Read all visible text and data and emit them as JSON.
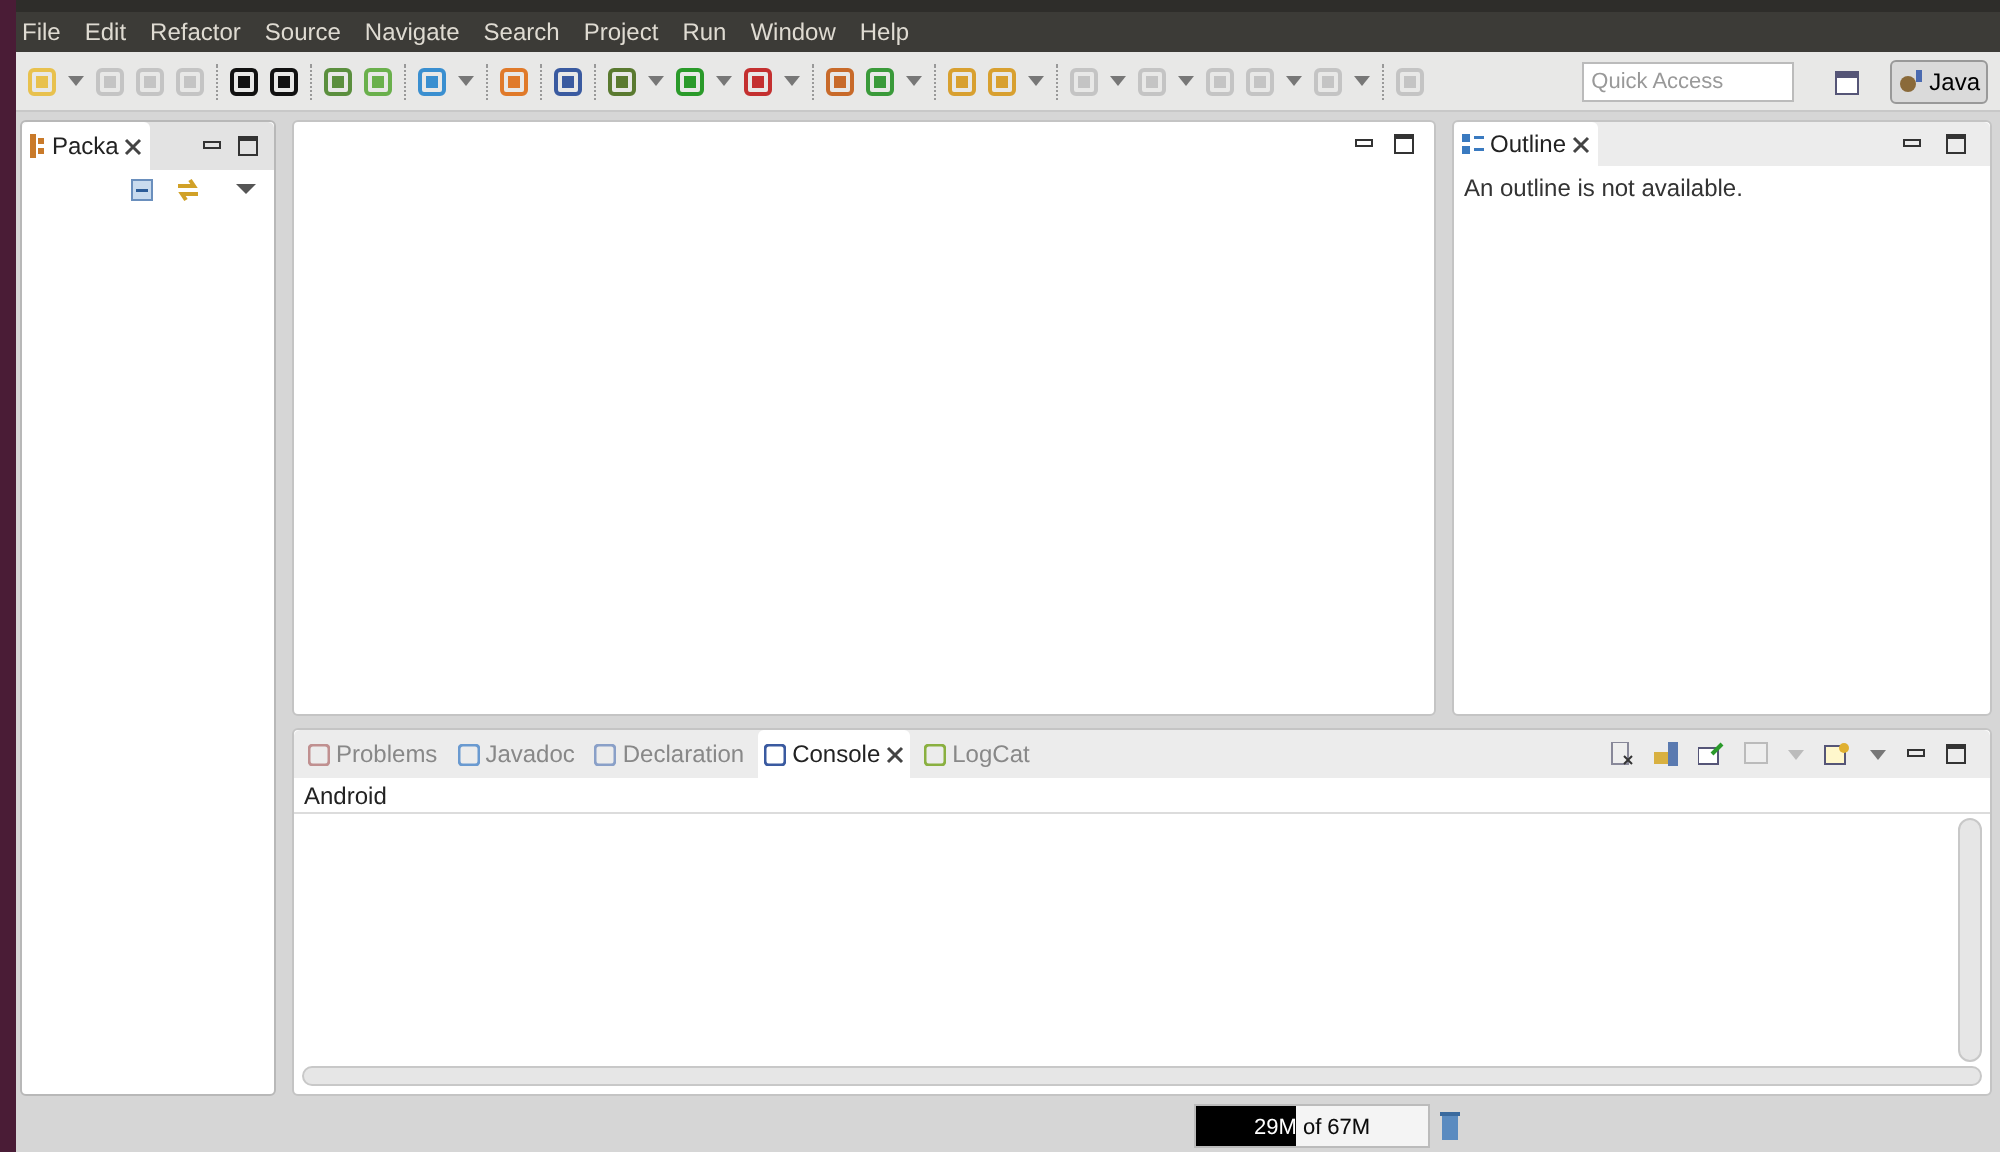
{
  "menu_bar": [
    "File",
    "Edit",
    "Refactor",
    "Source",
    "Navigate",
    "Search",
    "Project",
    "Run",
    "Window",
    "Help"
  ],
  "toolbar": {
    "quick_access": {
      "placeholder": "Quick Access"
    },
    "perspective": {
      "label": "Java",
      "selected": true
    }
  },
  "package_explorer": {
    "tab": {
      "label": "Packa",
      "selected": true
    }
  },
  "outline": {
    "tab": {
      "label": "Outline",
      "selected": true
    },
    "message": "An outline is not available."
  },
  "bottom_panel": {
    "tabs": [
      {
        "label": "Problems",
        "selected": false
      },
      {
        "label": "Javadoc",
        "selected": false
      },
      {
        "label": "Declaration",
        "selected": false
      },
      {
        "label": "Console",
        "selected": true
      },
      {
        "label": "LogCat",
        "selected": false
      }
    ],
    "console_title": "Android"
  },
  "status_bar": {
    "heap": "29M of 67M",
    "level": 0.43
  }
}
